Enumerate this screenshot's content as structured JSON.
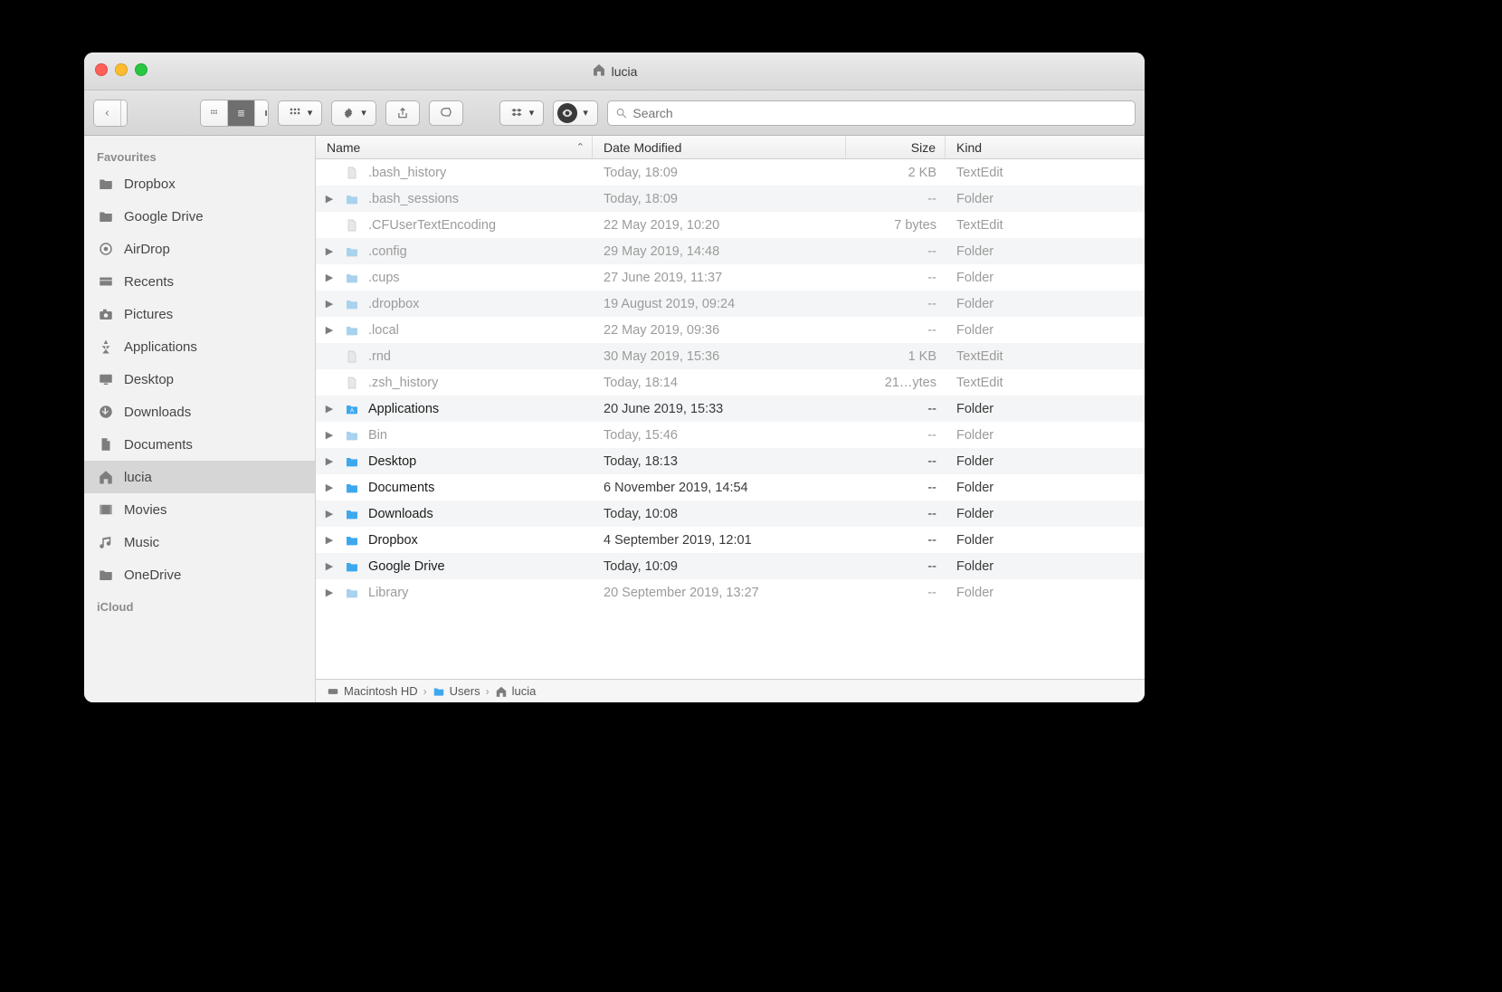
{
  "window": {
    "title": "lucia"
  },
  "toolbar": {
    "search_placeholder": "Search"
  },
  "columns": {
    "name": "Name",
    "date": "Date Modified",
    "size": "Size",
    "kind": "Kind"
  },
  "sidebar": {
    "sections": [
      {
        "title": "Favourites",
        "items": [
          {
            "label": "Dropbox",
            "icon": "folder",
            "selected": false
          },
          {
            "label": "Google Drive",
            "icon": "folder",
            "selected": false
          },
          {
            "label": "AirDrop",
            "icon": "airdrop",
            "selected": false
          },
          {
            "label": "Recents",
            "icon": "recents",
            "selected": false
          },
          {
            "label": "Pictures",
            "icon": "camera",
            "selected": false
          },
          {
            "label": "Applications",
            "icon": "apps",
            "selected": false
          },
          {
            "label": "Desktop",
            "icon": "desktop",
            "selected": false
          },
          {
            "label": "Downloads",
            "icon": "downloads",
            "selected": false
          },
          {
            "label": "Documents",
            "icon": "documents",
            "selected": false
          },
          {
            "label": "lucia",
            "icon": "home",
            "selected": true
          },
          {
            "label": "Movies",
            "icon": "movies",
            "selected": false
          },
          {
            "label": "Music",
            "icon": "music",
            "selected": false
          },
          {
            "label": "OneDrive",
            "icon": "folder",
            "selected": false
          }
        ]
      },
      {
        "title": "iCloud",
        "items": []
      }
    ]
  },
  "files": [
    {
      "name": ".bash_history",
      "date": "Today, 18:09",
      "size": "2 KB",
      "kind": "TextEdit",
      "type": "file",
      "hidden": true,
      "expandable": false
    },
    {
      "name": ".bash_sessions",
      "date": "Today, 18:09",
      "size": "--",
      "kind": "Folder",
      "type": "folder",
      "hidden": true,
      "expandable": true
    },
    {
      "name": ".CFUserTextEncoding",
      "date": "22 May 2019, 10:20",
      "size": "7 bytes",
      "kind": "TextEdit",
      "type": "file",
      "hidden": true,
      "expandable": false
    },
    {
      "name": ".config",
      "date": "29 May 2019, 14:48",
      "size": "--",
      "kind": "Folder",
      "type": "folder",
      "hidden": true,
      "expandable": true
    },
    {
      "name": ".cups",
      "date": "27 June 2019, 11:37",
      "size": "--",
      "kind": "Folder",
      "type": "folder",
      "hidden": true,
      "expandable": true
    },
    {
      "name": ".dropbox",
      "date": "19 August 2019, 09:24",
      "size": "--",
      "kind": "Folder",
      "type": "folder",
      "hidden": true,
      "expandable": true
    },
    {
      "name": ".local",
      "date": "22 May 2019, 09:36",
      "size": "--",
      "kind": "Folder",
      "type": "folder",
      "hidden": true,
      "expandable": true
    },
    {
      "name": ".rnd",
      "date": "30 May 2019, 15:36",
      "size": "1 KB",
      "kind": "TextEdit",
      "type": "file",
      "hidden": true,
      "expandable": false
    },
    {
      "name": ".zsh_history",
      "date": "Today, 18:14",
      "size": "21…ytes",
      "kind": "TextEdit",
      "type": "file",
      "hidden": true,
      "expandable": false
    },
    {
      "name": "Applications",
      "date": "20 June 2019, 15:33",
      "size": "--",
      "kind": "Folder",
      "type": "folder-apps",
      "hidden": false,
      "expandable": true
    },
    {
      "name": "Bin",
      "date": "Today, 15:46",
      "size": "--",
      "kind": "Folder",
      "type": "folder",
      "hidden": true,
      "expandable": true
    },
    {
      "name": "Desktop",
      "date": "Today, 18:13",
      "size": "--",
      "kind": "Folder",
      "type": "folder-sys",
      "hidden": false,
      "expandable": true
    },
    {
      "name": "Documents",
      "date": "6 November 2019, 14:54",
      "size": "--",
      "kind": "Folder",
      "type": "folder-sys",
      "hidden": false,
      "expandable": true
    },
    {
      "name": "Downloads",
      "date": "Today, 10:08",
      "size": "--",
      "kind": "Folder",
      "type": "folder-sys",
      "hidden": false,
      "expandable": true
    },
    {
      "name": "Dropbox",
      "date": "4 September 2019, 12:01",
      "size": "--",
      "kind": "Folder",
      "type": "folder-sys",
      "hidden": false,
      "expandable": true
    },
    {
      "name": "Google Drive",
      "date": "Today, 10:09",
      "size": "--",
      "kind": "Folder",
      "type": "folder-sys",
      "hidden": false,
      "expandable": true
    },
    {
      "name": "Library",
      "date": "20 September 2019, 13:27",
      "size": "--",
      "kind": "Folder",
      "type": "folder",
      "hidden": true,
      "expandable": true
    }
  ],
  "path": [
    "Macintosh HD",
    "Users",
    "lucia"
  ]
}
